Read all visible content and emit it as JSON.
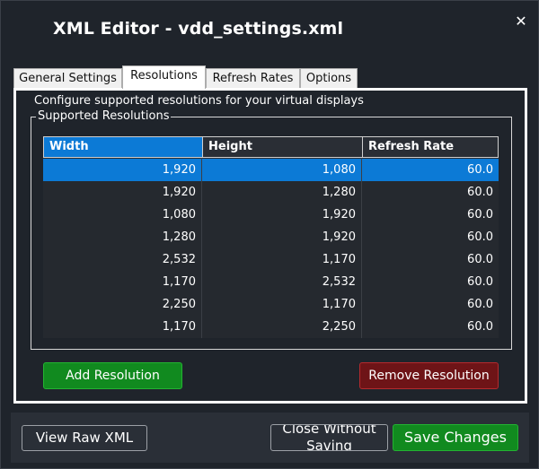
{
  "window": {
    "title": "XML Editor - vdd_settings.xml",
    "close_glyph": "✕"
  },
  "tabs": [
    {
      "label": "General Settings",
      "active": false
    },
    {
      "label": "Resolutions",
      "active": true
    },
    {
      "label": "Refresh Rates",
      "active": false
    },
    {
      "label": "Options",
      "active": false
    }
  ],
  "resolutions_tab": {
    "description": "Configure supported resolutions for your virtual displays",
    "group_title": "Supported Resolutions",
    "columns": [
      "Width",
      "Height",
      "Refresh Rate"
    ],
    "rows": [
      {
        "width": "1,920",
        "height": "1,080",
        "refresh": "60.0",
        "selected": true
      },
      {
        "width": "1,920",
        "height": "1,280",
        "refresh": "60.0",
        "selected": false
      },
      {
        "width": "1,080",
        "height": "1,920",
        "refresh": "60.0",
        "selected": false
      },
      {
        "width": "1,280",
        "height": "1,920",
        "refresh": "60.0",
        "selected": false
      },
      {
        "width": "2,532",
        "height": "1,170",
        "refresh": "60.0",
        "selected": false
      },
      {
        "width": "1,170",
        "height": "2,532",
        "refresh": "60.0",
        "selected": false
      },
      {
        "width": "2,250",
        "height": "1,170",
        "refresh": "60.0",
        "selected": false
      },
      {
        "width": "1,170",
        "height": "2,250",
        "refresh": "60.0",
        "selected": false
      }
    ],
    "add_button": "Add Resolution",
    "remove_button": "Remove Resolution"
  },
  "footer": {
    "view_raw_button": "View Raw XML",
    "close_without_saving_button": "Close Without Saving",
    "save_button": "Save Changes"
  },
  "colors": {
    "window_bg": "#1f242b",
    "selection": "#0c7ad6",
    "add_green": "#118a1f",
    "remove_red": "#6e1417"
  }
}
